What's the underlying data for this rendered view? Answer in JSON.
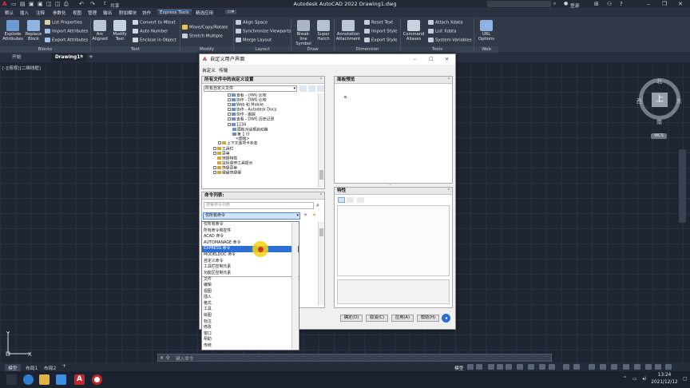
{
  "app": {
    "title": "Autodesk AutoCAD 2022   Drawing1.dwg",
    "share_label": "共享",
    "user_label": "登录"
  },
  "menu_tabs": [
    "默认",
    "插入",
    "注释",
    "参数化",
    "视图",
    "管理",
    "输出",
    "附加模块",
    "协作",
    "Express Tools",
    "精选应用"
  ],
  "ribbon": {
    "block_group": {
      "label": "Blocks",
      "big": [
        "Explode Attributes",
        "Replace Block"
      ],
      "rows": [
        "List Properties",
        "Import Attributes",
        "Export Attributes"
      ]
    },
    "text_group": {
      "label": "Text",
      "big": [
        "Arc Aligned",
        "Modify Text"
      ],
      "rows": [
        "Convert to Mtext",
        "Auto Number",
        "Enclose in Object"
      ]
    },
    "modify_group": {
      "label": "Modify",
      "rows": [
        "Move/Copy/Rotate",
        "Stretch Multiple"
      ]
    },
    "layout_group": {
      "label": "Layout",
      "rows": [
        "Align Space",
        "Synchronize Viewports",
        "Merge Layout"
      ]
    },
    "draw_group": {
      "label": "Draw",
      "big": [
        "Break-line Symbol",
        "Super Hatch"
      ]
    },
    "dimension_group": {
      "label": "Dimension",
      "big": [
        "Annotation Attachment"
      ],
      "rows": [
        "Reset Text",
        "Import Style",
        "Export Style"
      ]
    },
    "tools_group": {
      "label": "Tools",
      "big": [
        "Command Aliases"
      ],
      "rows": [
        "Attach Xdata",
        "List Xdata",
        "System Variables"
      ]
    },
    "web_group": {
      "label": "Web",
      "big": [
        "URL Options"
      ]
    }
  },
  "doc_tabs": [
    "开始",
    "Drawing1*"
  ],
  "view_control": "[-][俯视][二维线框]",
  "compass": {
    "n": "北",
    "s": "南",
    "e": "东",
    "w": "西",
    "cube": "上",
    "wcs": "WCS"
  },
  "command_placeholder": "键入命令",
  "layout_tabs": [
    "模型",
    "布局1",
    "布局2"
  ],
  "status_label": "模型",
  "clock": {
    "time": "13:24",
    "date": "2021/12/12"
  },
  "dialog": {
    "title": "自定义用户界面",
    "tabs": [
      "自定义",
      "传输"
    ],
    "custom_panel_title": "所有文件中的自定义设置",
    "custom_select": "所有自定义文件",
    "tree_items": [
      "查看 - DWG 比较",
      "协作 - DWG 比较",
      "Web 和 Mobile",
      "协作 - Autodesk Docs",
      "协作 - 跟踪",
      "查看 - DWG 历史记录",
      "1234",
      "面板对话框启动器",
      "第 1 行",
      "<面板>",
      "上下文选项卡状态",
      "工具栏",
      "菜单",
      "快捷特性",
      "鼠标悬停工具提示",
      "快捷菜单",
      "键盘快捷键"
    ],
    "preview_title": "面板预览",
    "props_title": "特性",
    "cmdlist_title": "命令列表:",
    "cmd_search_placeholder": "搜索命令列表",
    "cmd_filter_value": "仅所有命令",
    "dropdown_items": [
      "仅所有命令",
      "所有命令和控件",
      "ACAD 命令",
      "AUTOMANAGE 命令",
      "EXPRESS 命令",
      "MODELDOC 命令",
      "自定义命令",
      "工具栏控制元素",
      "功能区控制元素",
      "文件",
      "编辑",
      "视图",
      "插入",
      "格式",
      "工具",
      "绘图",
      "标注",
      "修改",
      "窗口",
      "帮助",
      "传统"
    ],
    "dropdown_selected_index": 4,
    "buttons": {
      "ok": "确定(O)",
      "cancel": "取消(C)",
      "apply": "应用(A)",
      "help": "帮助(H)"
    }
  }
}
